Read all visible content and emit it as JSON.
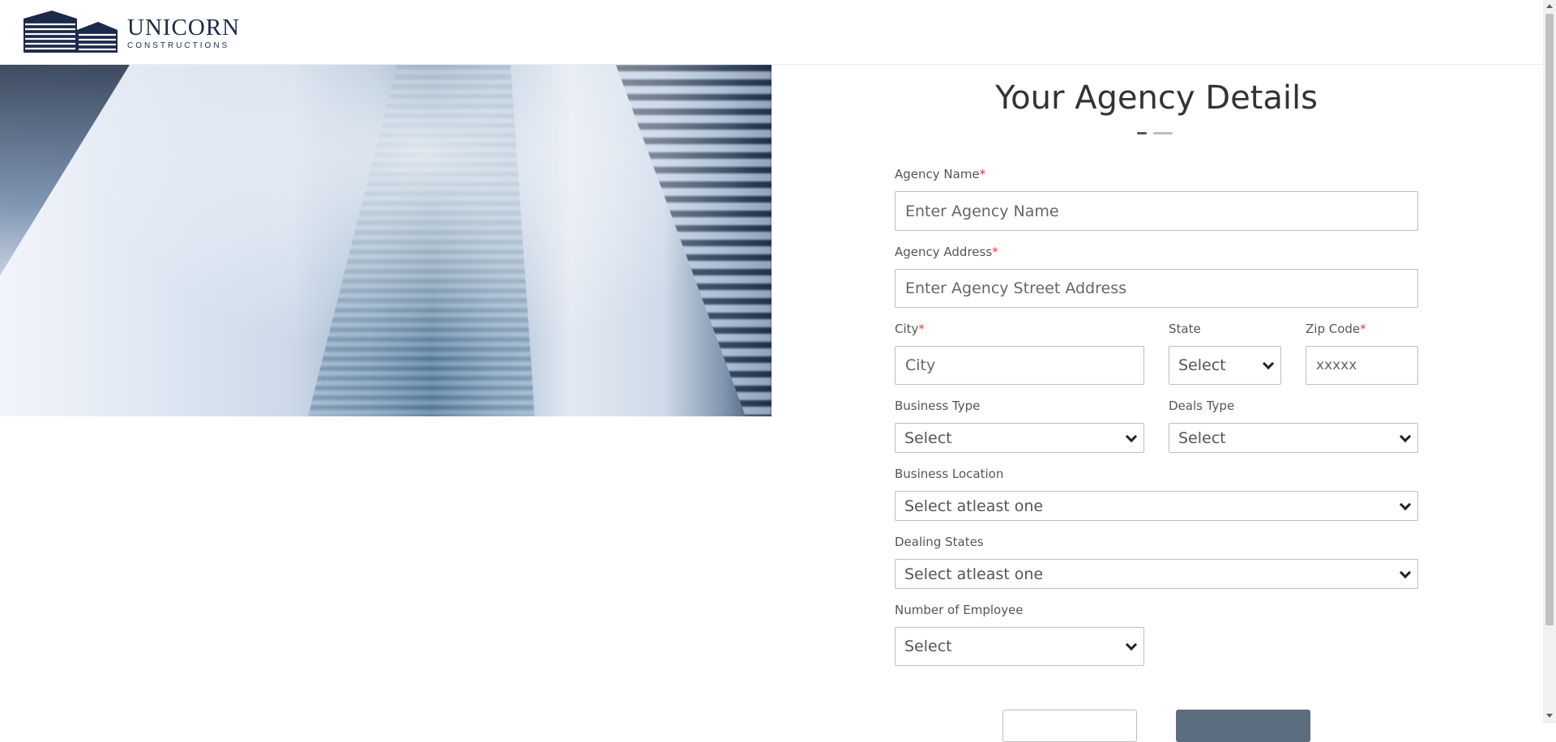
{
  "brand": {
    "name": "UNICORN",
    "tagline": "CONSTRUCTIONS",
    "color": "#1b2a4a"
  },
  "form": {
    "title": "Your Agency Details",
    "step_current": 1,
    "step_total": 2,
    "agency_name": {
      "label": "Agency Name",
      "required_mark": "*",
      "placeholder": "Enter Agency Name"
    },
    "agency_address": {
      "label": "Agency Address",
      "required_mark": "*",
      "placeholder": "Enter Agency Street Address"
    },
    "city": {
      "label": "City",
      "required_mark": "*",
      "placeholder": "City"
    },
    "state": {
      "label": "State",
      "value": "Select"
    },
    "zip": {
      "label": "Zip Code",
      "required_mark": "*",
      "placeholder": "xxxxx"
    },
    "business_type": {
      "label": "Business Type",
      "value": "Select"
    },
    "deals_type": {
      "label": "Deals Type",
      "value": "Select"
    },
    "business_location": {
      "label": "Business Location",
      "value": "Select atleast one"
    },
    "dealing_states": {
      "label": "Dealing States",
      "value": "Select atleast one"
    },
    "employees": {
      "label": "Number of Employee",
      "value": "Select"
    }
  },
  "colors": {
    "required": "#e33333",
    "primary_button": "#5d6d80"
  },
  "icons": [
    "chevron-down-icon",
    "building-logo-icon"
  ]
}
